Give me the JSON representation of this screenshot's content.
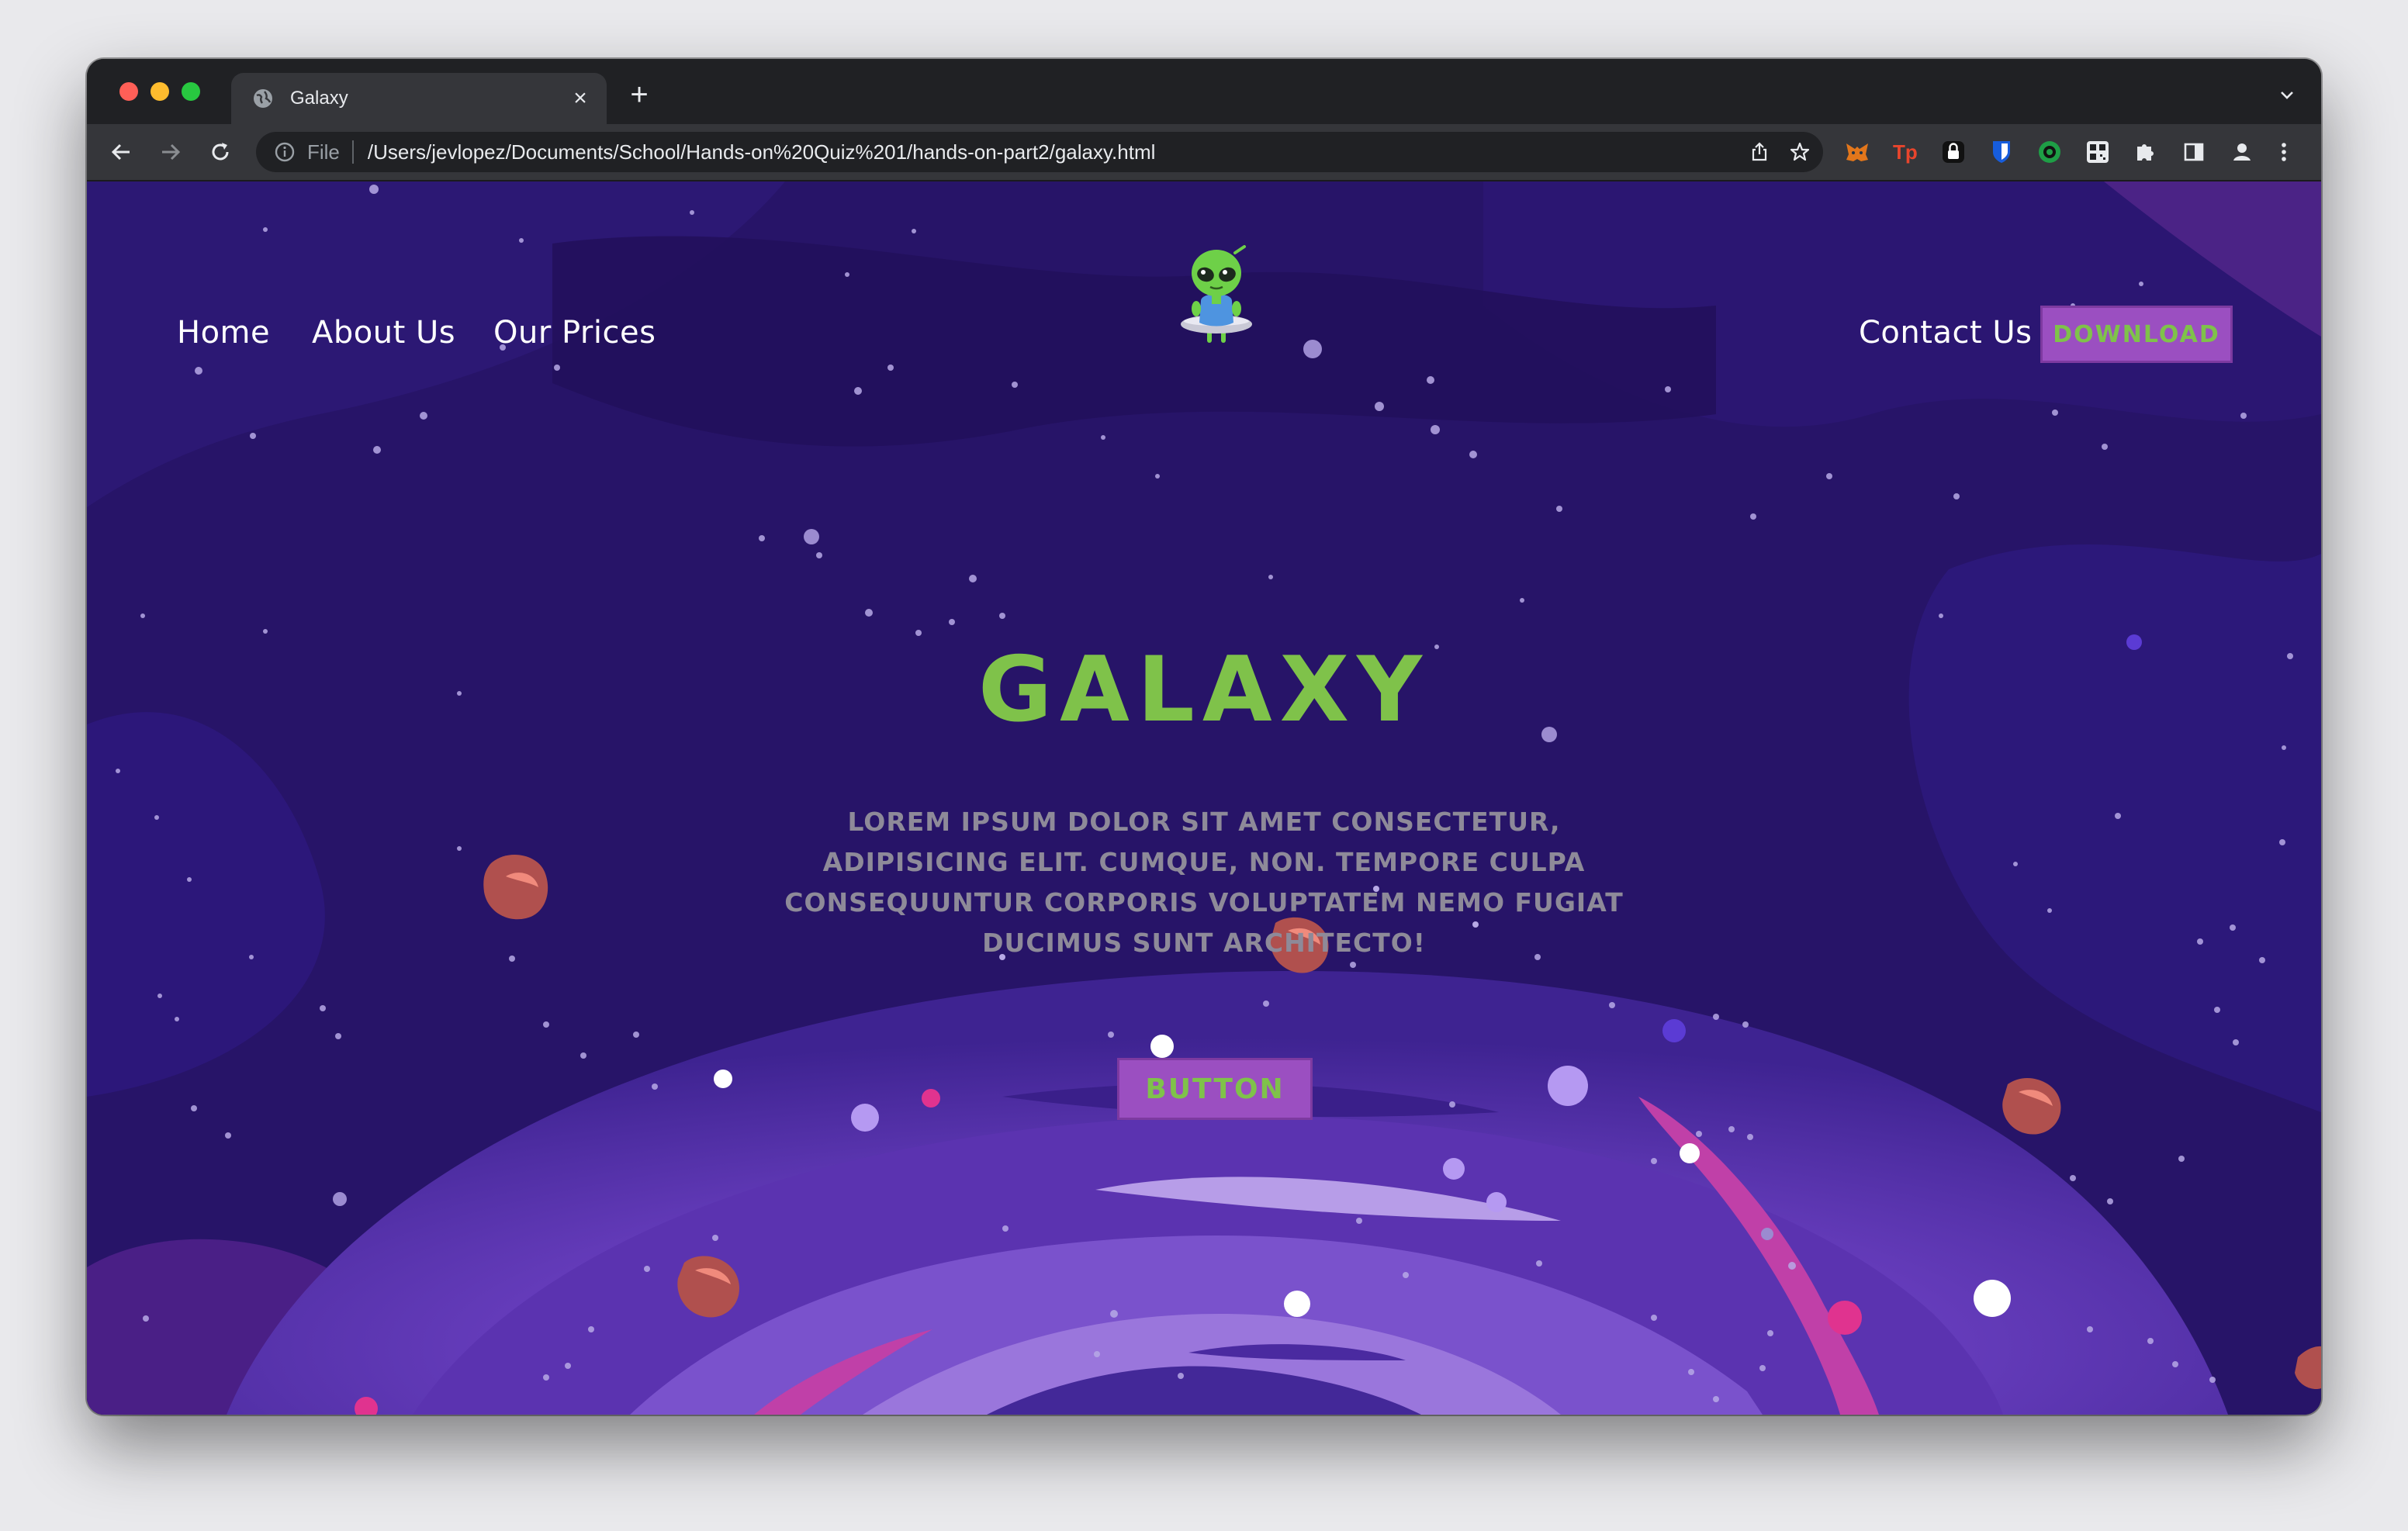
{
  "browser": {
    "tab_title": "Galaxy",
    "tab_close_glyph": "×",
    "new_tab_glyph": "+",
    "url_scheme_label": "File",
    "url": "/Users/jevlopez/Documents/School/Hands-on%20Quiz%201/hands-on-part2/galaxy.html",
    "extensions": [
      "metamask-icon",
      "tp-icon",
      "lock-icon",
      "bitwarden-icon",
      "green-circle-icon",
      "qr-code-icon",
      "puzzle-icon"
    ]
  },
  "site": {
    "nav_left": [
      "Home",
      "About Us",
      "Our Prices"
    ],
    "nav_right": "Contact Us",
    "download_label": "Download",
    "hero_title": "Galaxy",
    "hero_text": "Lorem ipsum dolor sit amet consectetur, adipisicing elit. Cumque, non. Tempore culpa consequuntur corporis voluptatem nemo fugiat ducimus sunt architecto!",
    "hero_button": "Button"
  },
  "colors": {
    "accent_green": "#7fc24a",
    "button_purple": "#9b4fc1",
    "background": "#261465"
  }
}
